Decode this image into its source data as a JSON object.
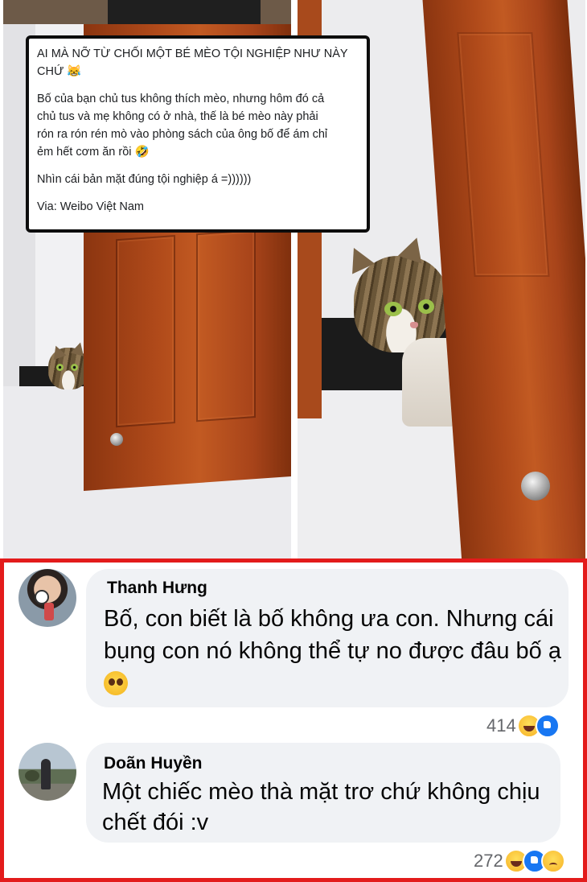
{
  "post": {
    "title_line1": "AI MÀ NỠ TỪ CHỐI MỘT BÉ MÈO TỘI NGHIỆP NHƯ NÀY",
    "title_line2": "CHỨ 😹",
    "body_line1": "Bố của bạn chủ tus không thích mèo, nhưng hôm đó cả",
    "body_line2": "chủ tus và mẹ không có ở nhà, thế là bé mèo này phải",
    "body_line3": "rón ra rón rén mò vào phòng sách của ông bố để ám chỉ",
    "body_line4": "ẻm hết cơm ăn rồi 🤣",
    "line5": "Nhìn cái bản mặt đúng tội nghiệp á =))))))",
    "source": "Via: Weibo Việt Nam"
  },
  "comments": [
    {
      "author": "Thanh Hưng",
      "text_line1": "Bố, con biết là bố không ưa con. Nhưng cái",
      "text_line2": "bụng con nó không thể tự no được đâu bố ạ",
      "reaction_count": "414",
      "reactions": [
        "haha-icon",
        "like-icon"
      ]
    },
    {
      "author": "Doãn Huyền",
      "text_line1": "Một chiếc mèo thà mặt trơ chứ không chịu",
      "text_line2": "chết đói :v",
      "reaction_count": "272",
      "reactions": [
        "haha-icon",
        "like-icon",
        "sad-icon"
      ]
    }
  ],
  "colors": {
    "highlight_border": "#e31b1b",
    "bubble": "#f0f2f5",
    "like_blue": "#1877f2"
  }
}
